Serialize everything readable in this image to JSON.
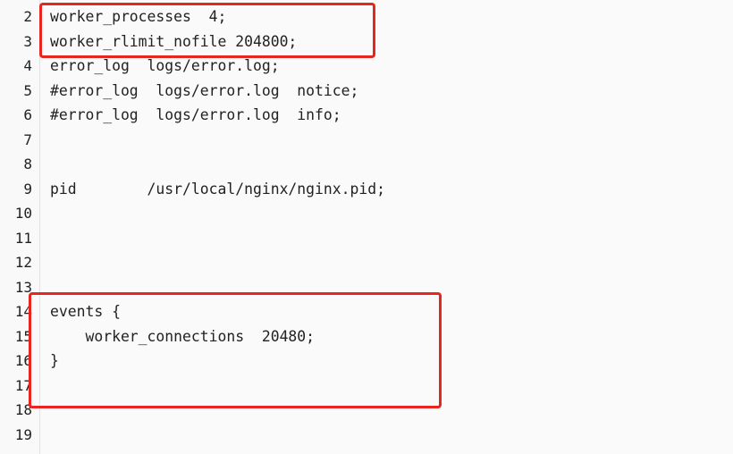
{
  "editor": {
    "clipped_text": "  ~ ~  ~ ~ ~  ~ ~  ~ );",
    "lines": [
      {
        "num": "2",
        "text": "worker_processes  4;"
      },
      {
        "num": "3",
        "text": "worker_rlimit_nofile 204800;"
      },
      {
        "num": "4",
        "text": "error_log  logs/error.log;"
      },
      {
        "num": "5",
        "text": "#error_log  logs/error.log  notice;"
      },
      {
        "num": "6",
        "text": "#error_log  logs/error.log  info;"
      },
      {
        "num": "7",
        "text": ""
      },
      {
        "num": "8",
        "text": ""
      },
      {
        "num": "9",
        "text": "pid        /usr/local/nginx/nginx.pid;"
      },
      {
        "num": "10",
        "text": ""
      },
      {
        "num": "11",
        "text": ""
      },
      {
        "num": "12",
        "text": ""
      },
      {
        "num": "13",
        "text": ""
      },
      {
        "num": "14",
        "text": "events {"
      },
      {
        "num": "15",
        "text": "    worker_connections  20480;"
      },
      {
        "num": "16",
        "text": "}"
      },
      {
        "num": "17",
        "text": ""
      },
      {
        "num": "18",
        "text": ""
      },
      {
        "num": "19",
        "text": ""
      }
    ]
  },
  "highlight_color": "#e8251f"
}
